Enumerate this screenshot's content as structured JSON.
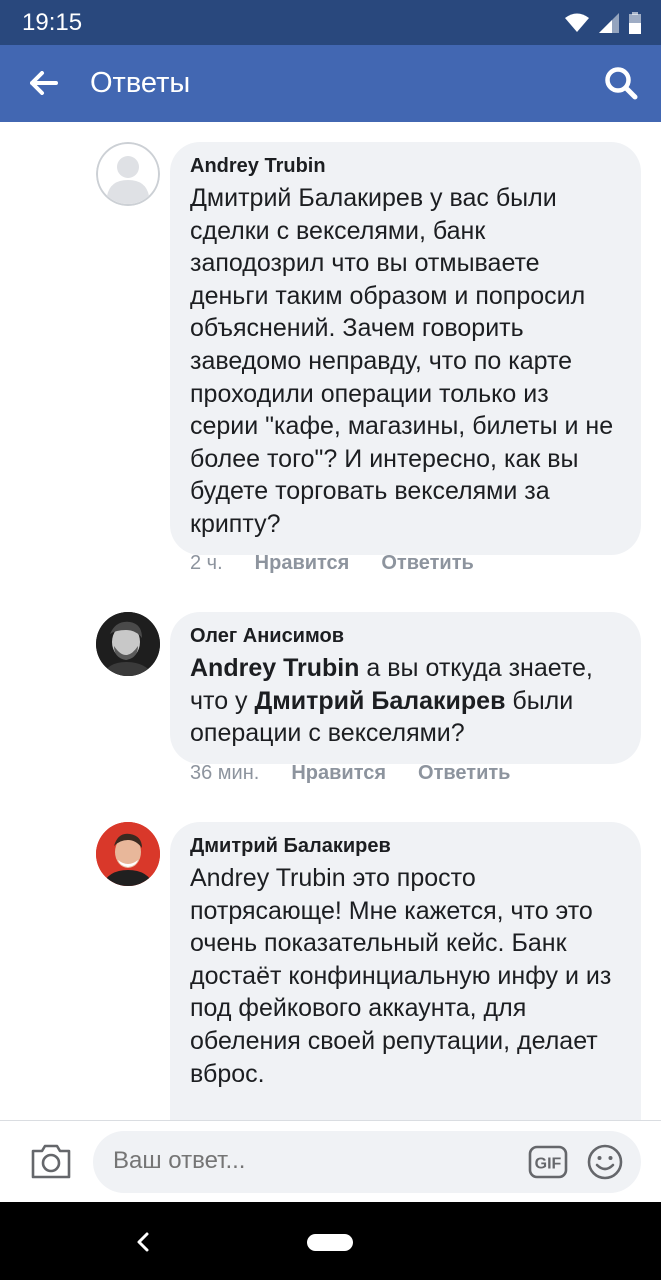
{
  "status": {
    "time": "19:15"
  },
  "appbar": {
    "title": "Ответы"
  },
  "comments": [
    {
      "author": "Andrey Trubin",
      "text": "Дмитрий Балакирев у вас были сделки с векселями, банк заподозрил что вы отмываете деньги таким образом и попросил объяснений. Зачем говорить заведомо неправду, что по карте проходили операции только из серии \"кафе, магазины, билеты и не более того\"? И интересно, как вы будете торговать векселями за крипту?",
      "time": "2 ч.",
      "like": "Нравится",
      "reply": "Ответить"
    },
    {
      "author": "Олег Анисимов",
      "mention1": "Andrey Trubin",
      "text1": " а вы откуда знаете, что у ",
      "mention2": "Дмитрий Балакирев",
      "text2": " были операции с векселями?",
      "time": "36 мин.",
      "like": "Нравится",
      "reply": "Ответить"
    },
    {
      "author": "Дмитрий Балакирев",
      "text": "Andrey Trubin это просто потрясающе! Мне кажется, что это очень показательный кейс. Банк достаёт конфинциальную инфу и из под фейкового аккаунта, для обеления своей репутации, делает вброс."
    }
  ],
  "composer": {
    "placeholder": "Ваш ответ...",
    "gif_label": "GIF"
  },
  "icons": {
    "back": "arrow-left-icon",
    "search": "search-icon",
    "camera": "camera-icon",
    "gif": "gif-icon",
    "emoji": "emoji-icon"
  },
  "colors": {
    "statusbar": "#29487d",
    "appbar": "#4267b2",
    "bubble": "#f0f2f5",
    "meta": "#8d949e"
  }
}
